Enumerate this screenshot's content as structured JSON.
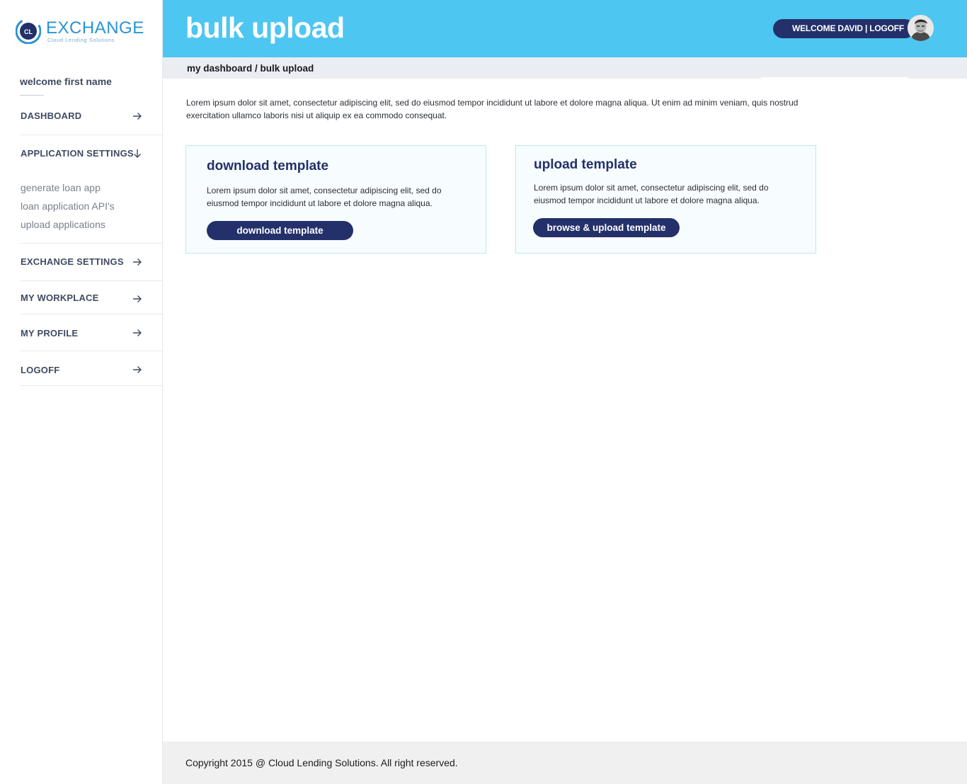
{
  "brand": {
    "mark_text": "CL",
    "name": "EXCHANGE",
    "tagline": "Cloud Lending Solutions",
    "primary_color": "#2a93d5",
    "navy_color": "#23306a"
  },
  "sidebar": {
    "welcome": "welcome first name",
    "items": [
      {
        "label": "DASHBOARD",
        "icon": "arrow-right-icon"
      },
      {
        "label": "APPLICATION SETTINGS",
        "icon": "arrow-down-icon"
      },
      {
        "label": "EXCHANGE SETTINGS",
        "icon": "arrow-right-icon"
      },
      {
        "label": "MY WORKPLACE",
        "icon": "arrow-right-icon"
      },
      {
        "label": "MY PROFILE",
        "icon": "arrow-right-icon"
      },
      {
        "label": "LOGOFF",
        "icon": "arrow-right-icon"
      }
    ],
    "sub_items": [
      "generate loan app",
      "loan application API's",
      "upload applications"
    ]
  },
  "header": {
    "title": "bulk upload",
    "user_greeting": "WELCOME DAVID | LOGOFF",
    "accent_color": "#4ec6f2"
  },
  "breadcrumb": "my dashboard / bulk upload",
  "intro": "Lorem ipsum dolor sit amet, consectetur adipiscing elit, sed do eiusmod tempor incididunt ut labore et dolore magna aliqua. Ut enim ad minim veniam, quis nostrud exercitation ullamco laboris nisi ut aliquip ex ea commodo consequat.",
  "cards": {
    "download": {
      "title": "download template",
      "text": "Lorem ipsum dolor sit amet, consectetur adipiscing elit, sed do eiusmod tempor incididunt ut labore et dolore magna aliqua.",
      "button": "download template"
    },
    "upload": {
      "title": "upload template",
      "text": "Lorem ipsum dolor sit amet, consectetur adipiscing elit, sed do eiusmod tempor incididunt ut labore et dolore magna aliqua.",
      "button": "browse & upload template"
    }
  },
  "footer": "Copyright 2015 @ Cloud Lending Solutions. All right reserved."
}
